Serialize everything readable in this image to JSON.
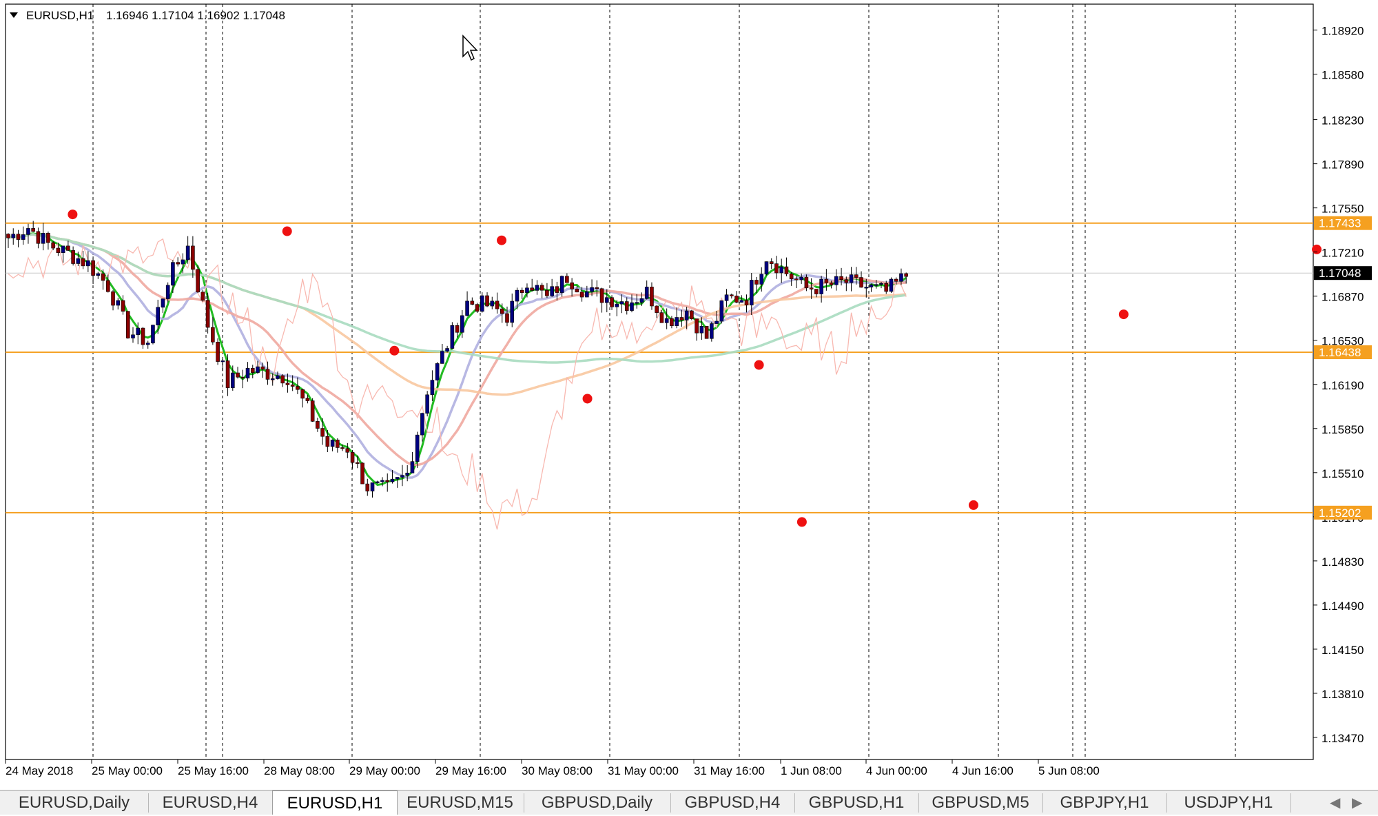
{
  "chart_header": {
    "symbol": "EURUSD,H1",
    "ohlc": "1.16946 1.17104 1.16902 1.17048"
  },
  "tabs": [
    {
      "label": "EURUSD,Daily",
      "active": false
    },
    {
      "label": "EURUSD,H4",
      "active": false
    },
    {
      "label": "EURUSD,H1",
      "active": true
    },
    {
      "label": "EURUSD,M15",
      "active": false
    },
    {
      "label": "GBPUSD,Daily",
      "active": false
    },
    {
      "label": "GBPUSD,H4",
      "active": false
    },
    {
      "label": "GBPUSD,H1",
      "active": false
    },
    {
      "label": "GBPUSD,M5",
      "active": false
    },
    {
      "label": "GBPJPY,H1",
      "active": false
    },
    {
      "label": "USDJPY,H1",
      "active": false
    }
  ],
  "chart_data": {
    "type": "candlestick",
    "symbol": "EURUSD",
    "timeframe": "H1",
    "ylim": [
      1.133,
      1.1912
    ],
    "y_ticks": [
      "1.18920",
      "1.18580",
      "1.18230",
      "1.17890",
      "1.17550",
      "1.17210",
      "1.16870",
      "1.16530",
      "1.16190",
      "1.15850",
      "1.15510",
      "1.15170",
      "1.14830",
      "1.14490",
      "1.14150",
      "1.13810",
      "1.13470"
    ],
    "x_ticks": [
      "24 May 2018",
      "25 May 00:00",
      "25 May 16:00",
      "28 May 08:00",
      "29 May 00:00",
      "29 May 16:00",
      "30 May 08:00",
      "31 May 00:00",
      "31 May 16:00",
      "1 Jun 08:00",
      "4 Jun 00:00",
      "4 Jun 16:00",
      "5 Jun 08:00"
    ],
    "current_price": {
      "value": 1.17048,
      "label": "1.17048"
    },
    "horizontal_levels": [
      {
        "value": 1.17433,
        "label": "1.17433",
        "color": "#f5a020"
      },
      {
        "value": 1.16438,
        "label": "1.16438",
        "color": "#f5a020"
      },
      {
        "value": 1.15202,
        "label": "1.15202",
        "color": "#f5a020"
      }
    ],
    "period_separators": [
      0,
      10.5,
      12,
      24,
      36,
      48,
      60,
      72,
      84,
      95,
      96.5,
      108,
      120
    ],
    "candles_anchor": [
      [
        0,
        1.1732
      ],
      [
        4,
        1.174
      ],
      [
        8,
        1.1727
      ],
      [
        12,
        1.172
      ],
      [
        16,
        1.1712
      ],
      [
        20,
        1.1695
      ],
      [
        24,
        1.166
      ],
      [
        28,
        1.1652
      ],
      [
        32,
        1.17
      ],
      [
        36,
        1.1725
      ],
      [
        40,
        1.1665
      ],
      [
        44,
        1.162
      ],
      [
        48,
        1.163
      ],
      [
        52,
        1.1628
      ],
      [
        56,
        1.1625
      ],
      [
        60,
        1.16
      ],
      [
        64,
        1.1572
      ],
      [
        68,
        1.157
      ],
      [
        72,
        1.154
      ],
      [
        76,
        1.1538
      ],
      [
        80,
        1.155
      ],
      [
        84,
        1.1615
      ],
      [
        88,
        1.165
      ],
      [
        92,
        1.1682
      ],
      [
        96,
        1.168
      ],
      [
        100,
        1.1672
      ],
      [
        104,
        1.17
      ],
      [
        108,
        1.1685
      ],
      [
        112,
        1.1702
      ],
      [
        116,
        1.169
      ],
      [
        120,
        1.1686
      ],
      [
        124,
        1.1682
      ],
      [
        128,
        1.169
      ],
      [
        132,
        1.1668
      ],
      [
        136,
        1.1676
      ],
      [
        140,
        1.1655
      ],
      [
        144,
        1.1685
      ],
      [
        148,
        1.1686
      ],
      [
        152,
        1.1718
      ],
      [
        156,
        1.1705
      ],
      [
        160,
        1.1693
      ],
      [
        164,
        1.1695
      ],
      [
        168,
        1.1698
      ],
      [
        172,
        1.1694
      ],
      [
        176,
        1.169
      ],
      [
        180,
        1.1703
      ]
    ],
    "fractal_points": [
      {
        "i": 3,
        "type": "high",
        "value": 1.175
      },
      {
        "i": 13,
        "type": "high",
        "value": 1.1737
      },
      {
        "i": 18,
        "type": "low",
        "value": 1.1645
      },
      {
        "i": 23,
        "type": "high",
        "value": 1.173
      },
      {
        "i": 27,
        "type": "low",
        "value": 1.1608
      },
      {
        "i": 35,
        "type": "high",
        "value": 1.1634
      },
      {
        "i": 37,
        "type": "low",
        "value": 1.1513
      },
      {
        "i": 45,
        "type": "low",
        "value": 1.1526
      },
      {
        "i": 52,
        "type": "high",
        "value": 1.1673
      },
      {
        "i": 61,
        "type": "high",
        "value": 1.1723
      },
      {
        "i": 65,
        "type": "low",
        "value": 1.164
      },
      {
        "i": 74,
        "type": "high",
        "value": 1.1716
      },
      {
        "i": 76,
        "type": "low",
        "value": 1.1618
      },
      {
        "i": 88,
        "type": "high",
        "value": 1.1744
      }
    ],
    "indicators": [
      {
        "type": "moving_average",
        "color": "#22bb22"
      },
      {
        "type": "moving_average",
        "color": "#b0b0e0"
      },
      {
        "type": "moving_average",
        "color": "#f0a8a0"
      },
      {
        "type": "moving_average",
        "color": "#f8c8a0"
      },
      {
        "type": "moving_average",
        "color": "#a8dcc0"
      },
      {
        "type": "oscillator_overlay",
        "color": "#f8b8b0"
      }
    ],
    "colors": {
      "bull_candle": "#000080",
      "bear_candle": "#8b0000",
      "fractal": "#ee1111",
      "level": "#f5a020",
      "grid": "#000000"
    }
  }
}
